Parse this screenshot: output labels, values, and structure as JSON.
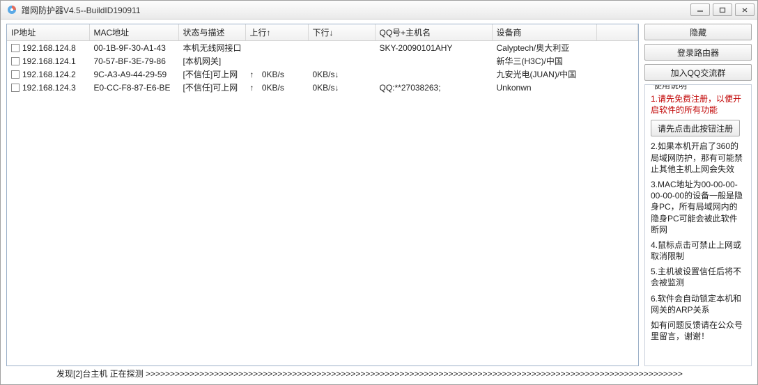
{
  "window": {
    "title": "蹭网防护器V4.5--BuildID190911"
  },
  "columns": {
    "ip": "IP地址",
    "mac": "MAC地址",
    "status": "状态与描述",
    "up": "上行↑",
    "down": "下行↓",
    "qq": "QQ号+主机名",
    "vendor": "设备商"
  },
  "rows": [
    {
      "ip": "192.168.124.8",
      "mac": "00-1B-9F-30-A1-43",
      "status": "本机无线网接口",
      "up_arrow": "",
      "up": "",
      "down": "",
      "qq": "SKY-20090101AHY",
      "vendor": "Calyptech/奥大利亚"
    },
    {
      "ip": "192.168.124.1",
      "mac": "70-57-BF-3E-79-86",
      "status": "[本机网关]",
      "up_arrow": "",
      "up": "",
      "down": "",
      "qq": "",
      "vendor": "新华三(H3C)/中国"
    },
    {
      "ip": "192.168.124.2",
      "mac": "9C-A3-A9-44-29-59",
      "status": "[不信任]可上网",
      "up_arrow": "↑",
      "up": "0KB/s",
      "down": "0KB/s↓",
      "qq": "",
      "vendor": "九安光电(JUAN)/中国"
    },
    {
      "ip": "192.168.124.3",
      "mac": "E0-CC-F8-87-E6-BE",
      "status": "[不信任]可上网",
      "up_arrow": "↑",
      "up": "0KB/s",
      "down": "0KB/s↓",
      "qq": "QQ:**27038263;",
      "vendor": "Unkonwn"
    }
  ],
  "side": {
    "hide": "隐藏",
    "login": "登录路由器",
    "qqgroup": "加入QQ交流群"
  },
  "help": {
    "legend": "使用说明",
    "line1": "1.请先免费注册，以便开启软件的所有功能",
    "reg_btn": "请先点击此按钮注册",
    "line2": "2.如果本机开启了360的局域网防护，那有可能禁止其他主机上网会失效",
    "line3": "3.MAC地址为00-00-00-00-00-00的设备一般是隐身PC，所有局域网内的隐身PC可能会被此软件断网",
    "line4": "4.鼠标点击可禁止上网或取消限制",
    "line5": "5.主机被设置信任后将不会被监测",
    "line6": "6.软件会自动锁定本机和网关的ARP关系",
    "line7": "如有问题反馈请在公众号里留言，谢谢！"
  },
  "status": {
    "text": "发现[2]台主机  正在探测 >>>>>>>>>>>>>>>>>>>>>>>>>>>>>>>>>>>>>>>>>>>>>>>>>>>>>>>>>>>>>>>>>>>>>>>>>>>>>>>>>>>>>>>>>>>>>>>>>>>>>>>>>>>>>>"
  }
}
